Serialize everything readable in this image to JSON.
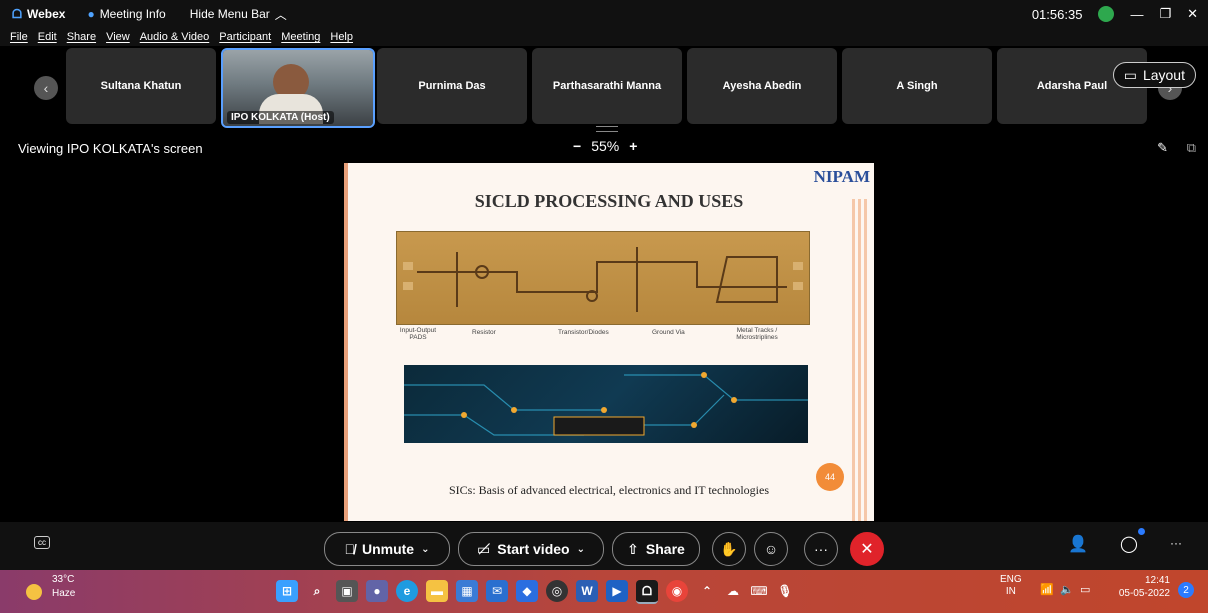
{
  "titlebar": {
    "app": "Webex",
    "meeting_info": "Meeting Info",
    "hide_menu": "Hide Menu Bar",
    "clock": "01:56:35"
  },
  "menu": [
    "File",
    "Edit",
    "Share",
    "View",
    "Audio & Video",
    "Participant",
    "Meeting",
    "Help"
  ],
  "participants": [
    "Sultana Khatun",
    "IPO KOLKATA (Host)",
    "Purnima Das",
    "Parthasarathi Manna",
    "Ayesha Abedin",
    "A Singh",
    "Adarsha Paul"
  ],
  "layout_label": "Layout",
  "viewing_label": "Viewing IPO KOLKATA's screen",
  "zoom": {
    "minus": "−",
    "value": "55%",
    "plus": "+"
  },
  "slide": {
    "logo": "NIPAM",
    "title": "SICLD PROCESSING AND USES",
    "labels": [
      "Input-Output PADS",
      "Resistor",
      "Transistor/Diodes",
      "Ground Via",
      "Metal Tracks / Microstriplines"
    ],
    "caption": "SICs: Basis of advanced electrical, electronics and IT technologies",
    "page": "44"
  },
  "controls": {
    "unmute": "Unmute",
    "start_video": "Start video",
    "share": "Share",
    "more": "···"
  },
  "taskbar": {
    "temp": "33°C",
    "weather": "Haze",
    "lang1": "ENG",
    "lang2": "IN",
    "time": "12:41",
    "date": "05-05-2022",
    "notif": "2"
  },
  "colors": {
    "accent": "#5aa0ff",
    "end": "#e0232a",
    "webex_green": "#2ea84e"
  }
}
